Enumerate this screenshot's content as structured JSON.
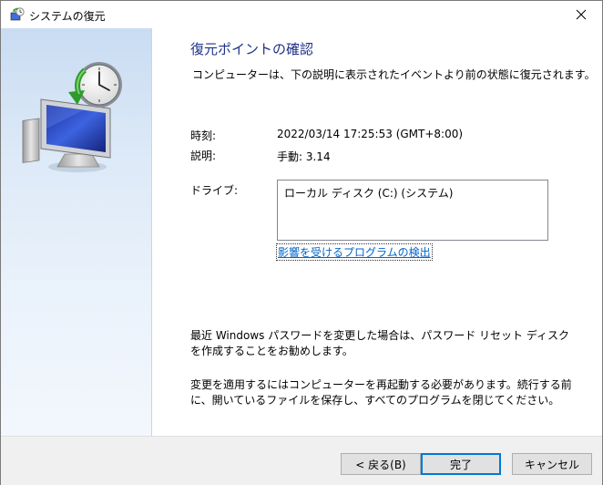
{
  "window": {
    "title": "システムの復元"
  },
  "main": {
    "heading": "復元ポイントの確認",
    "subtitle": "コンピューターは、下の説明に表示されたイベントより前の状態に復元されます。",
    "time_label": "時刻:",
    "time_value": "2022/03/14 17:25:53 (GMT+8:00)",
    "desc_label": "説明:",
    "desc_value": "手動: 3.14",
    "drive_label": "ドライブ:",
    "drives": [
      "ローカル ディスク (C:) (システム)"
    ],
    "scan_link": "影響を受けるプログラムの検出",
    "password_note": "最近 Windows パスワードを変更した場合は、パスワード リセット ディスクを作成することをお勧めします。",
    "restart_note": "変更を適用するにはコンピューターを再起動する必要があります。続行する前に、開いているファイルを保存し、すべてのプログラムを閉じてください。"
  },
  "footer": {
    "back_label": "< 戻る(B)",
    "finish_label": "完了",
    "cancel_label": "キャンセル"
  }
}
